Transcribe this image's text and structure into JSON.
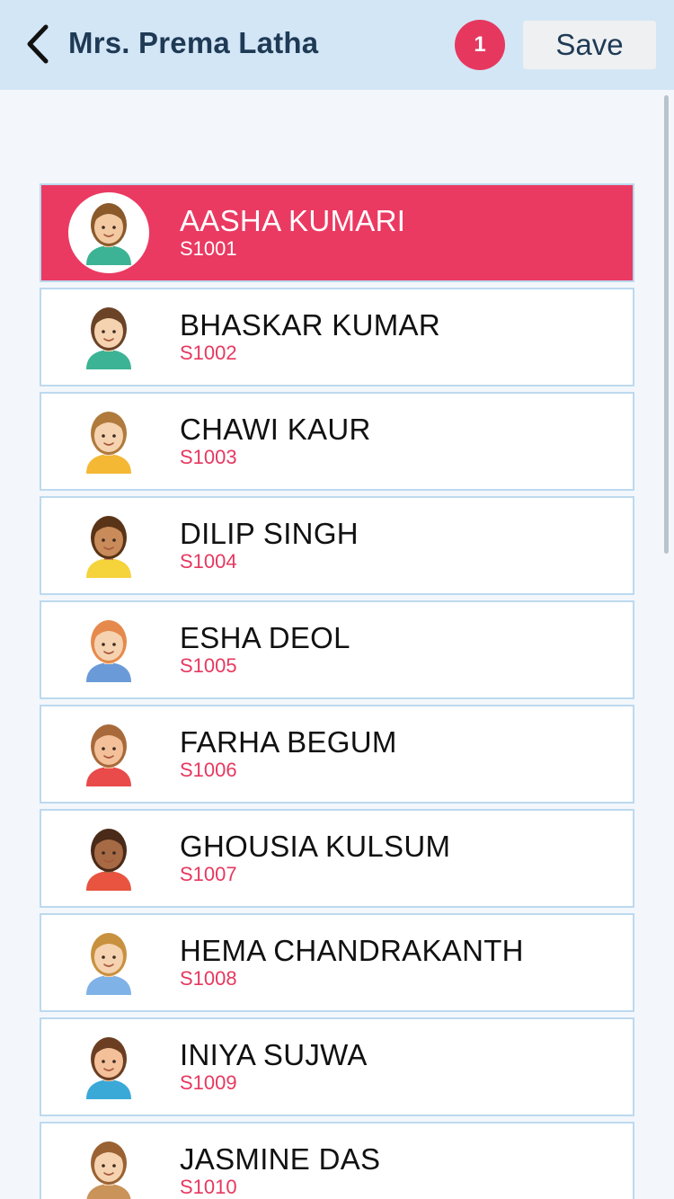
{
  "header": {
    "title": "Mrs. Prema Latha",
    "badge_count": "1",
    "save_label": "Save"
  },
  "colors": {
    "accent": "#ea3a62",
    "header_bg": "#d3e6f6",
    "title_text": "#1f3a55",
    "row_border": "#bcd9ef"
  },
  "students": [
    {
      "name": "AASHA KUMARI",
      "id": "S1001",
      "selected": true,
      "avatar": "girl-gold-earrings-avatar",
      "skin": "#f3c9a2",
      "hair": "#8a5a2b",
      "shirt": "#3cb394"
    },
    {
      "name": "BHASKAR KUMAR",
      "id": "S1002",
      "selected": false,
      "avatar": "boy-short-hair-avatar",
      "skin": "#f6d3b0",
      "hair": "#6b4327",
      "shirt": "#3cb394"
    },
    {
      "name": "CHAWI KAUR",
      "id": "S1003",
      "selected": false,
      "avatar": "girl-long-hair-avatar",
      "skin": "#f6d3b0",
      "hair": "#b07a3c",
      "shirt": "#f4b835"
    },
    {
      "name": "DILIP SINGH",
      "id": "S1004",
      "selected": false,
      "avatar": "boy-curly-hair-avatar",
      "skin": "#c98b5a",
      "hair": "#5a3417",
      "shirt": "#f5d33b"
    },
    {
      "name": "ESHA DEOL",
      "id": "S1005",
      "selected": false,
      "avatar": "girl-red-hair-avatar",
      "skin": "#f6d3b0",
      "hair": "#e58a4c",
      "shirt": "#6a9bd8"
    },
    {
      "name": "FARHA BEGUM",
      "id": "S1006",
      "selected": false,
      "avatar": "girl-bob-hair-avatar",
      "skin": "#f3c09a",
      "hair": "#a86a3a",
      "shirt": "#e94a4a"
    },
    {
      "name": "GHOUSIA KULSUM",
      "id": "S1007",
      "selected": false,
      "avatar": "girl-pigtails-avatar",
      "skin": "#a66a45",
      "hair": "#4a2a18",
      "shirt": "#e8543f"
    },
    {
      "name": "HEMA CHANDRAKANTH",
      "id": "S1008",
      "selected": false,
      "avatar": "girl-glasses-avatar",
      "skin": "#f6d3b0",
      "hair": "#c8913f",
      "shirt": "#7fb2e6"
    },
    {
      "name": "INIYA SUJWA",
      "id": "S1009",
      "selected": false,
      "avatar": "girl-braids-avatar",
      "skin": "#f3c09a",
      "hair": "#6b3e22",
      "shirt": "#3aa9d8"
    },
    {
      "name": "JASMINE DAS",
      "id": "S1010",
      "selected": false,
      "avatar": "girl-headband-avatar",
      "skin": "#f6d3b0",
      "hair": "#9a6233",
      "shirt": "#c9935a"
    }
  ]
}
